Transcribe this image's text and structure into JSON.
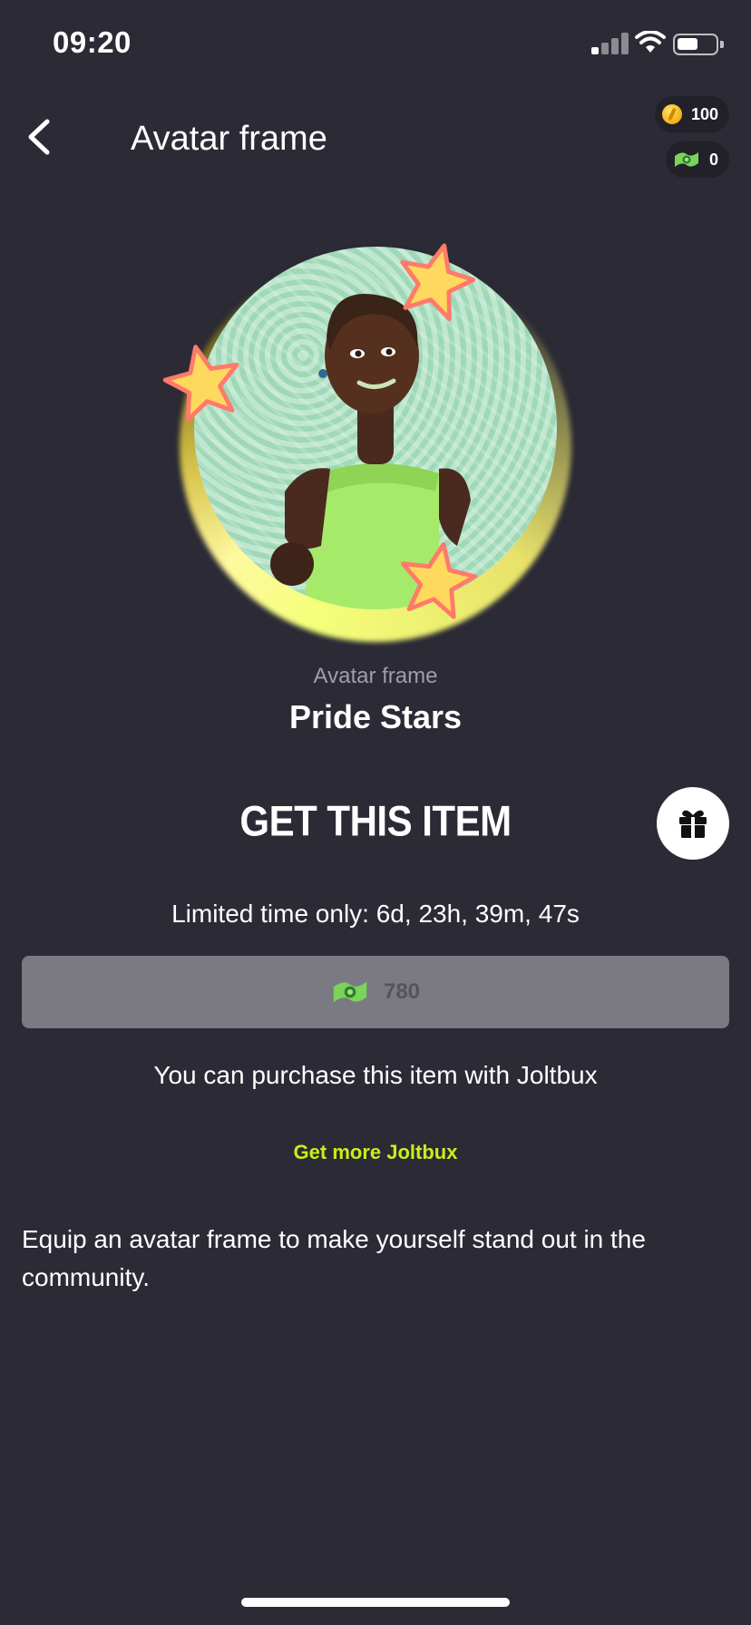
{
  "status_bar": {
    "time": "09:20",
    "icons": [
      "cellular-signal-icon",
      "wifi-icon",
      "battery-icon"
    ]
  },
  "header": {
    "back_icon": "chevron-left-icon",
    "title": "Avatar frame"
  },
  "balances": {
    "coins": {
      "icon": "coin-icon",
      "value": "100"
    },
    "joltbux": {
      "icon": "joltbux-icon",
      "value": "0"
    }
  },
  "preview": {
    "frame_name": "Pride Stars",
    "frame_color": "#f4ff7a",
    "background_color": "#a7dcbc"
  },
  "item": {
    "category": "Avatar frame",
    "name": "Pride Stars"
  },
  "purchase": {
    "section_title": "GET THIS ITEM",
    "gift_icon": "gift-icon",
    "limited_time": "Limited time only: 6d, 23h, 39m, 47s",
    "price": "780",
    "price_icon": "joltbux-icon",
    "note": "You can purchase this item with Joltbux",
    "get_more_label": "Get more Joltbux",
    "accent_color": "#c6f01b"
  },
  "description": "Equip an avatar frame to make yourself stand out in the community."
}
